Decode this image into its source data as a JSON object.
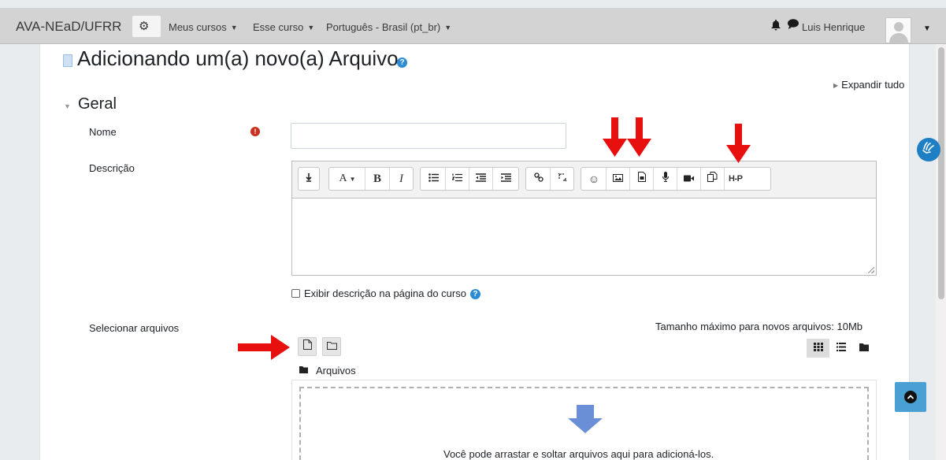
{
  "navbar": {
    "brand": "AVA-NEaD/UFRR",
    "gear_icon": "cogs-icon",
    "menus": [
      "Meus cursos",
      "Esse curso",
      "Português - Brasil (pt_br)"
    ],
    "user_name": "Luis Henrique"
  },
  "page": {
    "title": "Adicionando um(a) novo(a) Arquivo",
    "expand_all": "Expandir tudo"
  },
  "section": {
    "title": "Geral"
  },
  "form": {
    "name_label": "Nome",
    "name_value": "",
    "description_label": "Descrição",
    "show_description_label": "Exibir descrição na página do curso",
    "show_description_checked": false,
    "select_files_label": "Selecionar arquivos",
    "max_size_text": "Tamanho máximo para novos arquivos: 10Mb",
    "folder_label": "Arquivos",
    "drop_text": "Você pode arrastar e soltar arquivos aqui para adicioná-los."
  },
  "editor_toolbar": {
    "groups": [
      [
        "collapse-icon"
      ],
      [
        "font-color-icon",
        "bold-icon",
        "italic-icon"
      ],
      [
        "unordered-list-icon",
        "ordered-list-icon",
        "outdent-icon",
        "indent-icon"
      ],
      [
        "link-icon",
        "unlink-icon"
      ],
      [
        "emoji-icon",
        "image-icon",
        "media-icon",
        "record-audio-icon",
        "record-video-icon",
        "manage-files-icon",
        "h5p-icon"
      ]
    ],
    "h5p_label": "H-P"
  },
  "colors": {
    "annotation_arrow": "#e8100f",
    "accent": "#2b8bd4",
    "required": "#ca3120"
  }
}
